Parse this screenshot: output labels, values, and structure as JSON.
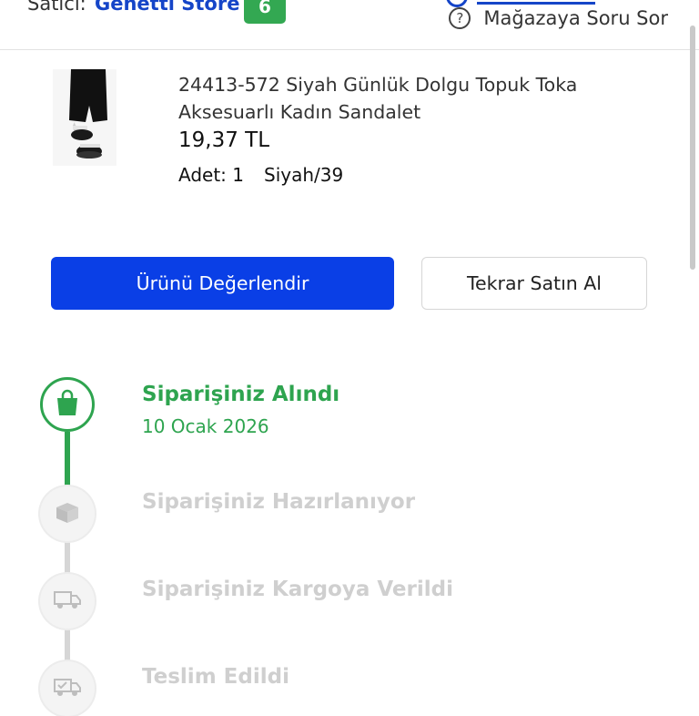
{
  "seller": {
    "label": "Satıcı:",
    "name": "Genetti Store",
    "score": "6",
    "ask_label": "Mağazaya Soru Sor",
    "ask_icon": "question-circle-icon"
  },
  "product": {
    "title": "24413-572 Siyah Günlük Dolgu Topuk Toka Aksesuarlı Kadın Sandalet",
    "price": "19,37 TL",
    "quantity": "Adet: 1",
    "variant": "Siyah/39"
  },
  "actions": {
    "review_label": "Ürünü Değerlendir",
    "rebuy_label": "Tekrar Satın Al"
  },
  "timeline": [
    {
      "title": "Siparişiniz Alındı",
      "date": "10 Ocak 2026",
      "icon": "shopping-bag-icon",
      "active": true
    },
    {
      "title": "Siparişiniz Hazırlanıyor",
      "icon": "box-icon",
      "active": false
    },
    {
      "title": "Siparişiniz Kargoya Verildi",
      "icon": "truck-icon",
      "active": false
    },
    {
      "title": "Teslim Edildi",
      "icon": "delivered-truck-icon",
      "active": false
    }
  ],
  "colors": {
    "primary": "#0a3fe6",
    "success": "#2ea44f",
    "inactive": "#cfcfcf",
    "link": "#1545c8"
  }
}
